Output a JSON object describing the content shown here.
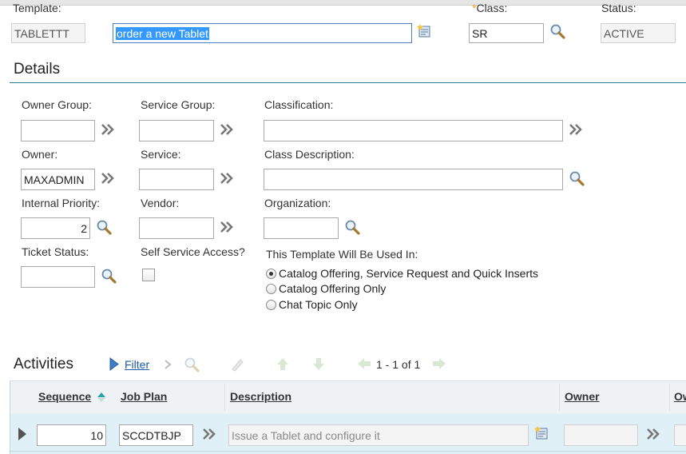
{
  "header": {
    "template_label": "Template:",
    "template_value": "TABLETTT",
    "description_value": "order a new Tablet",
    "class_required_mark": "*",
    "class_label": "Class:",
    "class_value": "SR",
    "status_label": "Status:",
    "status_value": "ACTIVE"
  },
  "details": {
    "section_title": "Details",
    "owner_group_label": "Owner Group:",
    "owner_group_value": "",
    "service_group_label": "Service Group:",
    "service_group_value": "",
    "classification_label": "Classification:",
    "classification_value": "",
    "owner_label": "Owner:",
    "owner_value": "MAXADMIN",
    "service_label": "Service:",
    "service_value": "",
    "class_description_label": "Class Description:",
    "class_description_value": "",
    "internal_priority_label": "Internal Priority:",
    "internal_priority_value": "2",
    "vendor_label": "Vendor:",
    "vendor_value": "",
    "organization_label": "Organization:",
    "organization_value": "",
    "ticket_status_label": "Ticket Status:",
    "ticket_status_value": "",
    "self_service_label": "Self Service Access?",
    "self_service_checked": false,
    "used_in_label": "This Template Will Be Used In:",
    "used_in_options": [
      "Catalog Offering, Service Request and Quick Inserts",
      "Catalog Offering Only",
      "Chat Topic Only"
    ],
    "used_in_selected": "Catalog Offering, Service Request and Quick Inserts"
  },
  "activities": {
    "section_title": "Activities",
    "filter_label": "Filter",
    "pagination": "1 - 1 of 1",
    "columns": [
      "Sequence",
      "Job Plan",
      "Description",
      "Owner",
      "Ow"
    ],
    "rows": [
      {
        "sequence": "10",
        "job_plan": "SCCDTBJP",
        "description": "Issue a Tablet and configure it",
        "owner": ""
      }
    ]
  },
  "colors": {
    "accent_blue": "#1a5aa6",
    "table_header_bg": "#eef2f5",
    "selected_row_bg": "#dff0f7",
    "required_star": "#f5a623"
  }
}
